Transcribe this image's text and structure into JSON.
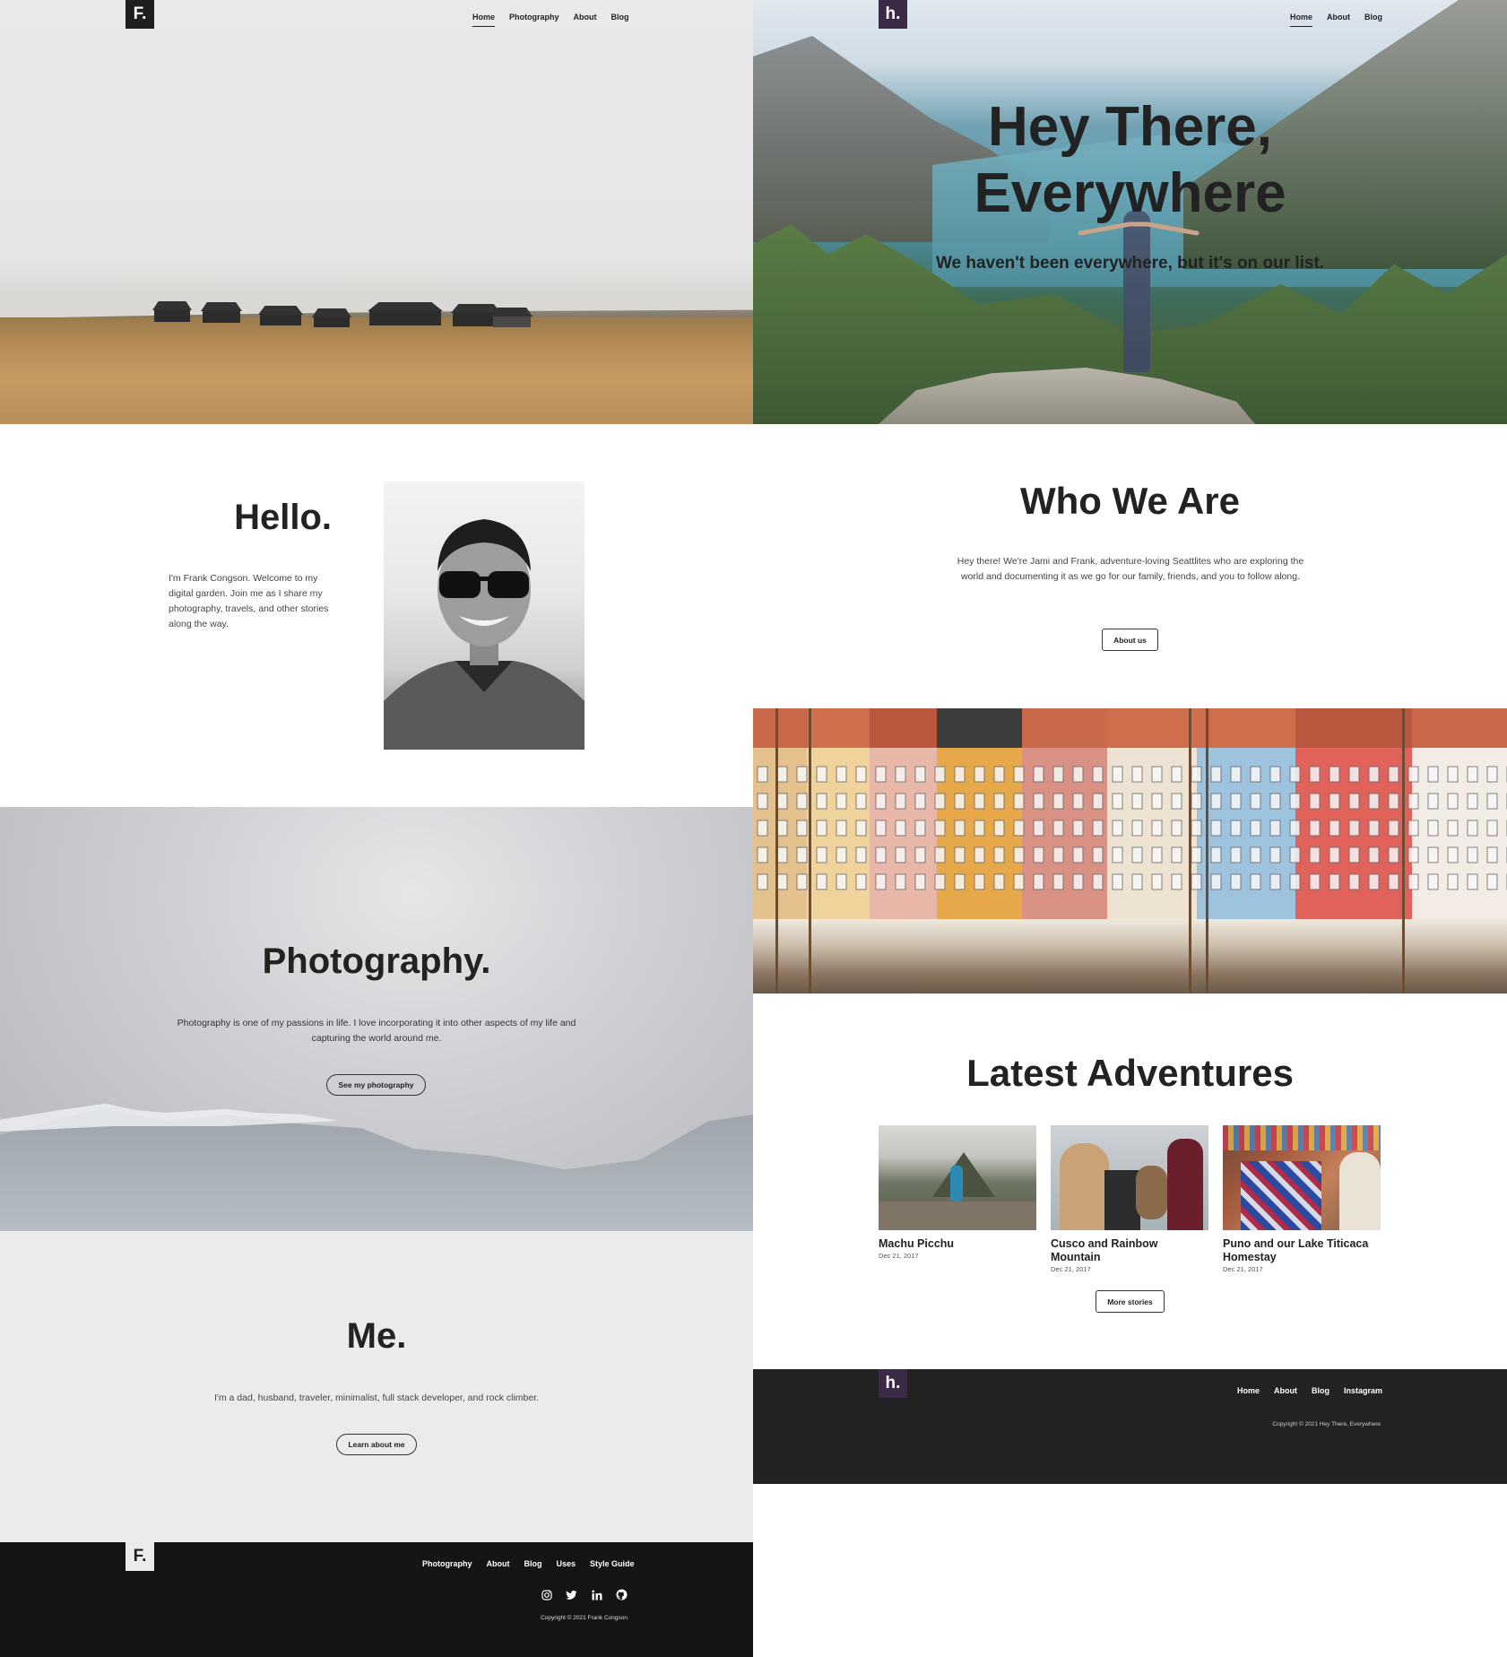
{
  "left_site": {
    "logo": "F.",
    "nav": [
      "Home",
      "Photography",
      "About",
      "Blog"
    ],
    "hello": {
      "title": "Hello.",
      "text": "I'm Frank Congson. Welcome to my digital garden. Join me as I share my photography, travels, and other stories along the way."
    },
    "photography": {
      "title": "Photography.",
      "text": "Photography is one of my passions in life. I love incorporating it into other aspects of my life and capturing the world around me.",
      "button": "See my photography"
    },
    "me": {
      "title": "Me.",
      "text": "I'm a dad, husband, traveler, minimalist, full stack developer, and rock climber.",
      "button": "Learn about me"
    },
    "footer": {
      "logo": "F.",
      "nav": [
        "Photography",
        "About",
        "Blog",
        "Uses",
        "Style Guide"
      ],
      "social_icons": [
        "instagram-icon",
        "twitter-icon",
        "linkedin-icon",
        "github-icon"
      ],
      "copyright": "Copyright © 2021 Frank Congson"
    }
  },
  "right_site": {
    "logo": "h.",
    "nav": [
      "Home",
      "About",
      "Blog"
    ],
    "hero": {
      "title_line1": "Hey There,",
      "title_line2": "Everywhere",
      "subtitle": "We haven't been everywhere, but it's on our list."
    },
    "who": {
      "title": "Who We Are",
      "text": "Hey there! We're Jami and Frank, adventure-loving Seattlites who are exploring the world and documenting it as we go for our family, friends, and you to follow along.",
      "button": "About us"
    },
    "latest": {
      "title": "Latest Adventures",
      "cards": [
        {
          "title": "Machu Picchu",
          "date": "Dec 21, 2017"
        },
        {
          "title": "Cusco and Rainbow Mountain",
          "date": "Dec 21, 2017"
        },
        {
          "title": "Puno and our Lake Titicaca Homestay",
          "date": "Dec 21, 2017"
        }
      ],
      "button": "More stories"
    },
    "footer": {
      "logo": "h.",
      "nav": [
        "Home",
        "About",
        "Blog",
        "Instagram"
      ],
      "copyright": "Copyright © 2021 Hey There, Everywhere"
    }
  },
  "colors": {
    "brand_purple": "#3b2a45",
    "dark_logo": "#1f1f1f",
    "footer_left": "#141414",
    "footer_right": "#222222"
  }
}
